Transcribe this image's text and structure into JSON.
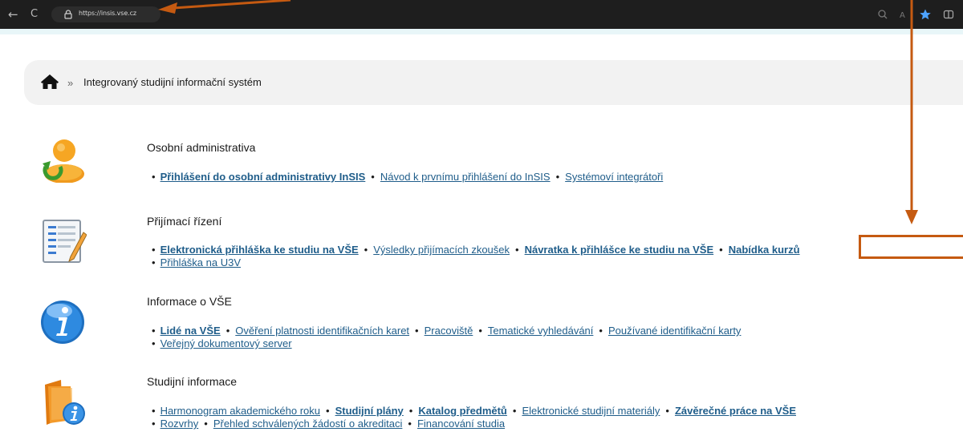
{
  "browser": {
    "url": "https://insis.vse.cz",
    "back_glyph": "←",
    "reload_glyph": "C"
  },
  "breadcrumb": {
    "separator": "»",
    "current": "Integrovaný studijní informační systém"
  },
  "sections": [
    {
      "title": "Osobní administrativa",
      "icon": "user-refresh-icon",
      "lines": [
        [
          {
            "text": "Přihlášení do osobní administrativy InSIS",
            "bold": true
          },
          {
            "text": "Návod k prvnímu přihlášení do InSIS",
            "bold": false
          },
          {
            "text": "Systémoví integrátoři",
            "bold": false
          }
        ]
      ]
    },
    {
      "title": "Přijímací řízení",
      "icon": "form-pencil-icon",
      "lines": [
        [
          {
            "text": "Elektronická přihláška ke studiu na VŠE",
            "bold": true
          },
          {
            "text": "Výsledky přijímacích zkoušek",
            "bold": false
          },
          {
            "text": "Návratka k přihlášce ke studiu na VŠE",
            "bold": true
          },
          {
            "text": "Nabídka kurzů",
            "bold": true
          }
        ],
        [
          {
            "text": "Přihláška na U3V",
            "bold": false
          }
        ]
      ]
    },
    {
      "title": "Informace o VŠE",
      "icon": "info-icon",
      "lines": [
        [
          {
            "text": "Lidé na VŠE",
            "bold": true
          },
          {
            "text": "Ověření platnosti identifikačních karet",
            "bold": false
          },
          {
            "text": "Pracoviště",
            "bold": false
          },
          {
            "text": "Tematické vyhledávání",
            "bold": false
          },
          {
            "text": "Používané identifikační karty",
            "bold": false
          }
        ],
        [
          {
            "text": "Veřejný dokumentový server",
            "bold": false
          }
        ]
      ]
    },
    {
      "title": "Studijní informace",
      "icon": "folder-info-icon",
      "lines": [
        [
          {
            "text": "Harmonogram akademického roku",
            "bold": false
          },
          {
            "text": "Studijní plány",
            "bold": true
          },
          {
            "text": "Katalog předmětů",
            "bold": true
          },
          {
            "text": "Elektronické studijní materiály",
            "bold": false
          },
          {
            "text": "Závěrečné práce na VŠE",
            "bold": true
          }
        ],
        [
          {
            "text": "Rozvrhy",
            "bold": false
          },
          {
            "text": "Přehled schválených žádostí o akreditaci",
            "bold": false
          },
          {
            "text": "Financování studia",
            "bold": false
          }
        ]
      ]
    }
  ],
  "colors": {
    "link": "#1f5d8a",
    "annotation": "#c55a11",
    "browser_bar": "#1e1e1e"
  }
}
